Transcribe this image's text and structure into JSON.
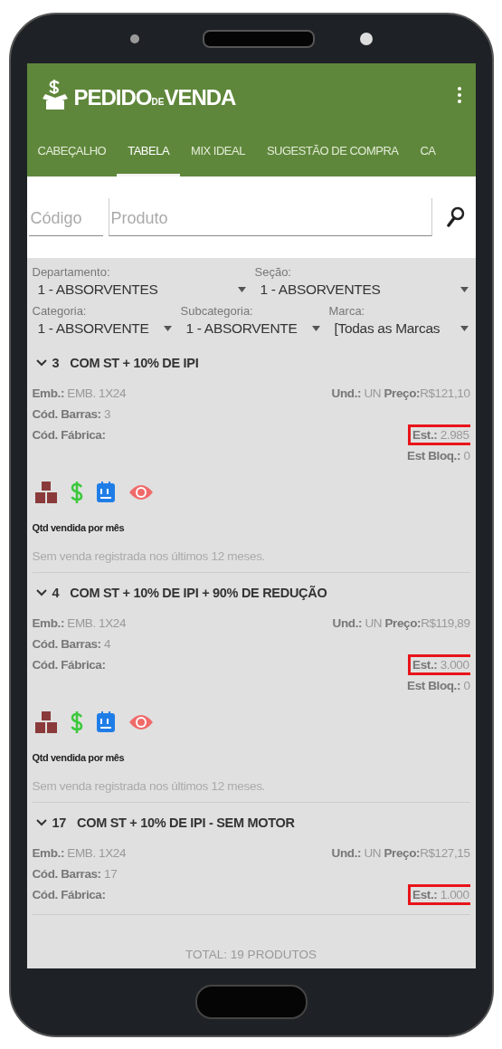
{
  "app_bar": {
    "logo_text": {
      "main": "PEDIDO",
      "small": "DE",
      "end": "VENDA"
    }
  },
  "tabs": [
    {
      "label": "CABEÇALHO",
      "selected": false
    },
    {
      "label": "TABELA",
      "selected": true
    },
    {
      "label": "MIX IDEAL",
      "selected": false
    },
    {
      "label": "SUGESTÃO DE COMPRA",
      "selected": false
    },
    {
      "label": "CA",
      "selected": false
    }
  ],
  "search": {
    "code_placeholder": "Código",
    "product_placeholder": "Produto"
  },
  "filters": [
    [
      {
        "label": "Departamento:",
        "value": "1 - ABSORVENTES"
      },
      {
        "label": "Seção:",
        "value": "1 - ABSORVENTES"
      }
    ],
    [
      {
        "label": "Categoria:",
        "value": "1 - ABSORVENTE"
      },
      {
        "label": "Subcategoria:",
        "value": "1 - ABSORVENTE"
      },
      {
        "label": "Marca:",
        "value": "[Todas as Marcas"
      }
    ]
  ],
  "products": [
    {
      "code": "3",
      "name": "COM ST + 10% DE IPI",
      "emb_label": "Emb.:",
      "emb": "EMB. 1X24",
      "und_label": "Und.:",
      "und": "UN",
      "price_label": "Preço:",
      "price": "R$121,10",
      "barcode_label": "Cód. Barras:",
      "barcode": "3",
      "factory_label": "Cód. Fábrica:",
      "stock_label": "Est.:",
      "stock": "2.985",
      "highlighted": true,
      "blocked_label": "Est Bloq.:",
      "blocked": "0",
      "sales_title": "Qtd vendida por mês",
      "sales_note": "Sem venda registrada nos últimos 12 meses."
    },
    {
      "code": "4",
      "name": "COM ST + 10% DE IPI + 90% DE REDUÇÃO",
      "emb_label": "Emb.:",
      "emb": "EMB. 1X24",
      "und_label": "Und.:",
      "und": "UN",
      "price_label": "Preço:",
      "price": "R$119,89",
      "barcode_label": "Cód. Barras:",
      "barcode": "4",
      "factory_label": "Cód. Fábrica:",
      "stock_label": "Est.:",
      "stock": "3.000",
      "highlighted": true,
      "blocked_label": "Est Bloq.:",
      "blocked": "0",
      "sales_title": "Qtd vendida por mês",
      "sales_note": "Sem venda registrada nos últimos 12 meses."
    },
    {
      "code": "17",
      "name": "COM ST + 10% DE IPI - SEM MOTOR",
      "emb_label": "Emb.:",
      "emb": "EMB. 1X24",
      "und_label": "Und.:",
      "und": "UN",
      "price_label": "Preço:",
      "price": "R$127,15",
      "barcode_label": "Cód. Barras:",
      "barcode": "17",
      "factory_label": "Cód. Fábrica:",
      "stock_label": "Est.:",
      "stock": "1.000",
      "highlighted": true
    }
  ],
  "footer": {
    "total": "TOTAL: 19 PRODUTOS"
  }
}
